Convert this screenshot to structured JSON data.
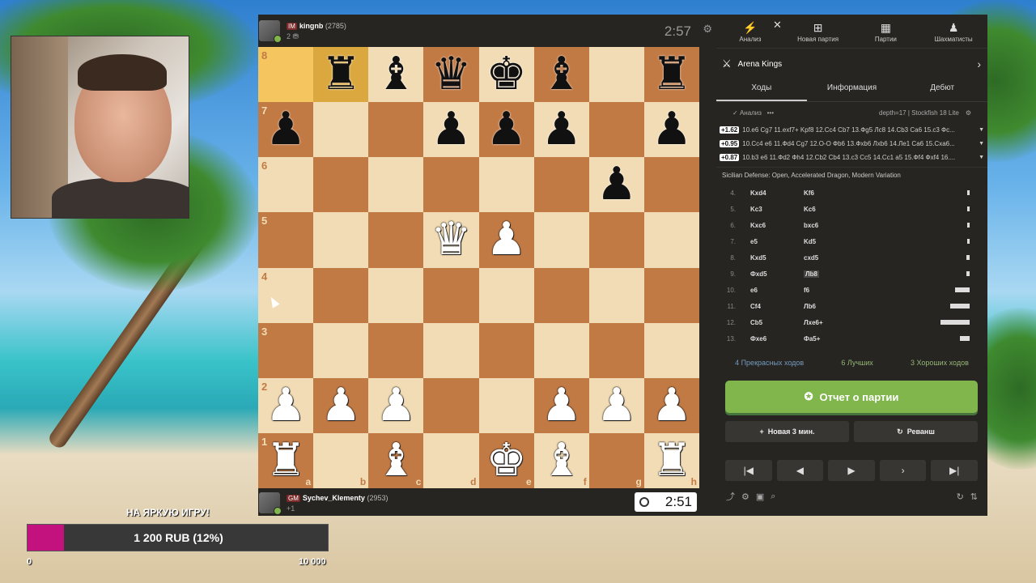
{
  "top_player": {
    "title": "IM",
    "name": "kingnb",
    "rating": "(2785)",
    "sub": "2 ⛃",
    "clock": "2:57"
  },
  "bottom_player": {
    "title": "GM",
    "name": "Sychev_Klementy",
    "rating": "(2953)",
    "sub": "+1",
    "clock": "2:51"
  },
  "board": {
    "ranks": [
      "8",
      "7",
      "6",
      "5",
      "4",
      "3",
      "2",
      "1"
    ],
    "files": [
      "a",
      "b",
      "c",
      "d",
      "e",
      "f",
      "g",
      "h"
    ],
    "rows": [
      [
        "",
        "bR",
        "bB",
        "bQ",
        "bK",
        "bB",
        "",
        "bR"
      ],
      [
        "bP",
        "",
        "",
        "bP",
        "bP",
        "bP",
        "",
        "bP"
      ],
      [
        "",
        "",
        "",
        "",
        "",
        "",
        "bP",
        ""
      ],
      [
        "",
        "",
        "",
        "wQ",
        "wP",
        "",
        "",
        ""
      ],
      [
        "",
        "",
        "",
        "",
        "",
        "",
        "",
        ""
      ],
      [
        "",
        "",
        "",
        "",
        "",
        "",
        "",
        ""
      ],
      [
        "wP",
        "wP",
        "wP",
        "",
        "",
        "wP",
        "wP",
        "wP"
      ],
      [
        "wR",
        "",
        "wB",
        "",
        "wK",
        "wB",
        "",
        "wR"
      ]
    ],
    "highlight": [
      "a8",
      "b8"
    ]
  },
  "side": {
    "nav": [
      {
        "icon": "⚡",
        "label": "Анализ"
      },
      {
        "icon": "⊞",
        "label": "Новая партия"
      },
      {
        "icon": "▦",
        "label": "Партии"
      },
      {
        "icon": "♟",
        "label": "Шахматисты"
      }
    ],
    "arena": "Arena Kings",
    "tabs": [
      "Ходы",
      "Информация",
      "Дебют"
    ],
    "analysis_label": "Анализ",
    "engine": "depth=17 | Stockfish 18 Lite",
    "lines": [
      {
        "eval": "+1.62",
        "text": "10.e6 Cg7 11.exf7+ Kpf8 12.Cc4 Cb7 13.Фg5 Лс8 14.Cb3 Ca6 15.c3 Фс..."
      },
      {
        "eval": "+0.95",
        "text": "10.Cc4 e6 11.Фd4 Cg7 12.O-O Фb6 13.Фxb6 Лxb6 14.Ле1 Ca6 15.Cxa6..."
      },
      {
        "eval": "+0.87",
        "text": "10.b3 e6 11.Фd2 Фh4 12.Cb2 Cb4 13.c3 Cc5 14.Cc1 a5 15.Фf4 Фxf4 16...."
      }
    ],
    "opening": "Sicilian Defense: Open, Accelerated Dragon, Modern Variation",
    "moves": [
      {
        "n": "4.",
        "w": "Kxd4",
        "b": "Kf6",
        "bar": 0.05
      },
      {
        "n": "5.",
        "w": "Kc3",
        "b": "Kc6",
        "bar": 0.05
      },
      {
        "n": "6.",
        "w": "Kxc6",
        "b": "bxc6",
        "bar": 0.05
      },
      {
        "n": "7.",
        "w": "e5",
        "b": "Kd5",
        "bar": 0.05
      },
      {
        "n": "8.",
        "w": "Kxd5",
        "b": "cxd5",
        "bar": 0.06
      },
      {
        "n": "9.",
        "w": "Фxd5",
        "b": "Лb8",
        "bar": 0.06,
        "sel": true
      },
      {
        "n": "10.",
        "w": "e6",
        "b": "f6",
        "bar": 0.3
      },
      {
        "n": "11.",
        "w": "Cf4",
        "b": "Лb6",
        "bar": 0.4
      },
      {
        "n": "12.",
        "w": "Cb5",
        "b": "Лxe6+",
        "bar": 0.6
      },
      {
        "n": "13.",
        "w": "Фxe6",
        "b": "Фa5+",
        "bar": 0.2
      }
    ],
    "summary": [
      "4 Прекрасных ходов",
      "6 Лучших",
      "3 Хороших ходов"
    ],
    "report": "Отчет о партии",
    "new_game": "Новая 3 мин.",
    "rematch": "Реванш"
  },
  "donation": {
    "title": "НА ЯРКУЮ ИГРУ!",
    "text": "1 200 RUB (12%)",
    "percent": 12,
    "min": "0",
    "max": "10 000",
    "color": "#c3127e"
  }
}
